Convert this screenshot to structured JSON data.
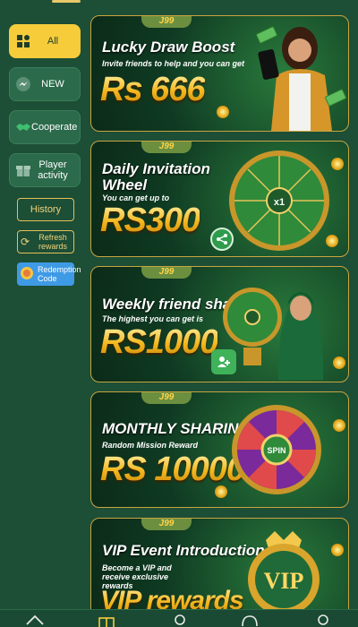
{
  "sidebar": {
    "categories": [
      {
        "label": "All",
        "icon": "grid-icon",
        "active": true
      },
      {
        "label": "NEW",
        "icon": "messenger-icon",
        "active": false
      },
      {
        "label": "Cooperate",
        "icon": "handshake-icon",
        "active": false
      },
      {
        "label": "Player activity",
        "icon": "gift-icon",
        "active": false
      }
    ],
    "history_label": "History",
    "refresh_label": "Refresh rewards",
    "redeem_label": "Redemption Code"
  },
  "banners": [
    {
      "brand": "J99",
      "title": "Lucky Draw Boost",
      "subtitle": "Invite friends to help and you can get",
      "amount": "Rs 666"
    },
    {
      "brand": "J99",
      "title": "Daily Invitation Wheel",
      "subtitle": "You can get up to",
      "amount": "RS300"
    },
    {
      "brand": "J99",
      "title": "Weekly friend sharing",
      "subtitle": "The highest you can get is",
      "amount": "RS1000"
    },
    {
      "brand": "J99",
      "title": "MONTHLY SHARING",
      "subtitle": "Random Mission Reward",
      "amount": "RS 10000"
    },
    {
      "brand": "J99",
      "title": "VIP Event Introduction",
      "subtitle": "Become a VIP and receive exclusive rewards",
      "amount": "VIP rewards"
    }
  ],
  "wheel_center_label": "x1",
  "spin_label": "SPIN",
  "vip_badge": "VIP",
  "colors": {
    "background": "#1d4e36",
    "accent": "#f6cc3b",
    "banner_border": "#c9a43f"
  }
}
